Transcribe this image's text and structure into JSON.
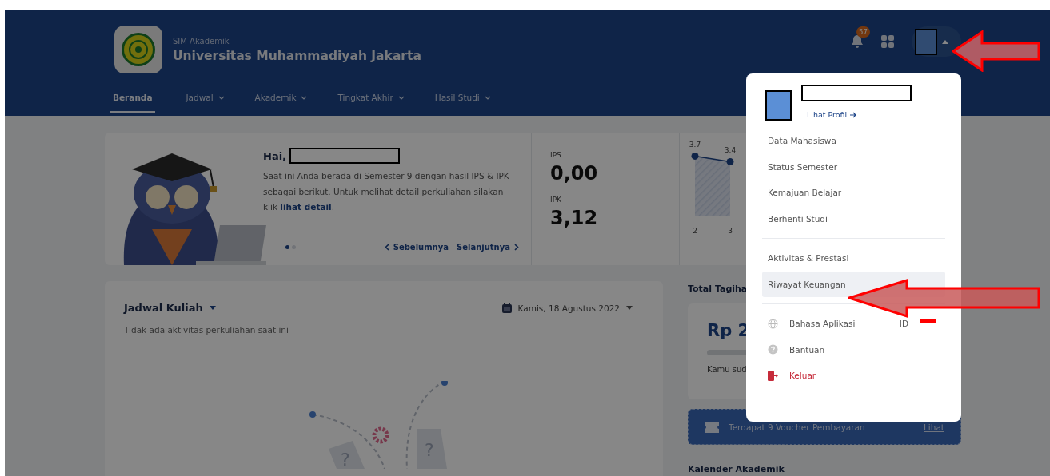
{
  "header": {
    "app_name": "SIM Akademik",
    "university": "Universitas Muhammadiyah Jakarta",
    "notification_count": "57"
  },
  "nav": [
    {
      "label": "Beranda",
      "selected": true,
      "dropdown": false
    },
    {
      "label": "Jadwal",
      "selected": false,
      "dropdown": true
    },
    {
      "label": "Akademik",
      "selected": false,
      "dropdown": true
    },
    {
      "label": "Tingkat Akhir",
      "selected": false,
      "dropdown": true
    },
    {
      "label": "Hasil Studi",
      "selected": false,
      "dropdown": true
    }
  ],
  "greeting": {
    "hello": "Hai,",
    "message": "Saat ini Anda berada di Semester 9 dengan hasil IPS & IPK sebagai berikut. Untuk melihat detail perkuliahan silakan klik",
    "link": "lihat detail",
    "after": ".",
    "slides": [
      {
        "selected": true
      },
      {
        "selected": false
      }
    ],
    "prev": "Sebelumnya",
    "next": "Selanjutnya"
  },
  "scores": [
    {
      "label": "IPS",
      "value": "0,00"
    },
    {
      "label": "IPK",
      "value": "3,12"
    }
  ],
  "chart_data": {
    "type": "area",
    "categories": [
      "2",
      "3"
    ],
    "values": [
      3.7,
      3.4
    ],
    "data_labels": true
  },
  "schedule": {
    "title": "Jadwal Kuliah",
    "date": "Kamis, 18 Agustus 2022",
    "empty": "Tidak ada aktivitas perkuliahan saat ini",
    "marks": [
      "?",
      "?"
    ]
  },
  "billing": {
    "title": "Total Tagiha",
    "amount": "Rp 2",
    "note": "Kamu sud"
  },
  "voucher": {
    "text": "Terdapat 9 Voucher Pembayaran",
    "link": "Lihat"
  },
  "calendar_title": "Kalender Akademik",
  "profile_menu": {
    "profile_link": "Lihat Profil",
    "groups": [
      [
        {
          "label": "Data Mahasiswa",
          "kind": "link",
          "selected": false
        },
        {
          "label": "Status Semester",
          "kind": "link",
          "selected": false
        },
        {
          "label": "Kemajuan Belajar",
          "kind": "link",
          "selected": false
        },
        {
          "label": "Berhenti Studi",
          "kind": "link",
          "selected": false
        }
      ],
      [
        {
          "label": "Aktivitas & Prestasi",
          "kind": "link",
          "selected": false
        },
        {
          "label": "Riwayat Keuangan",
          "kind": "link",
          "selected": true
        }
      ],
      [
        {
          "label": "Bahasa Aplikasi",
          "kind": "language",
          "value": "ID",
          "selected": false
        },
        {
          "label": "Bantuan",
          "kind": "help",
          "selected": false
        },
        {
          "label": "Keluar",
          "kind": "logout",
          "selected": false
        }
      ]
    ]
  }
}
